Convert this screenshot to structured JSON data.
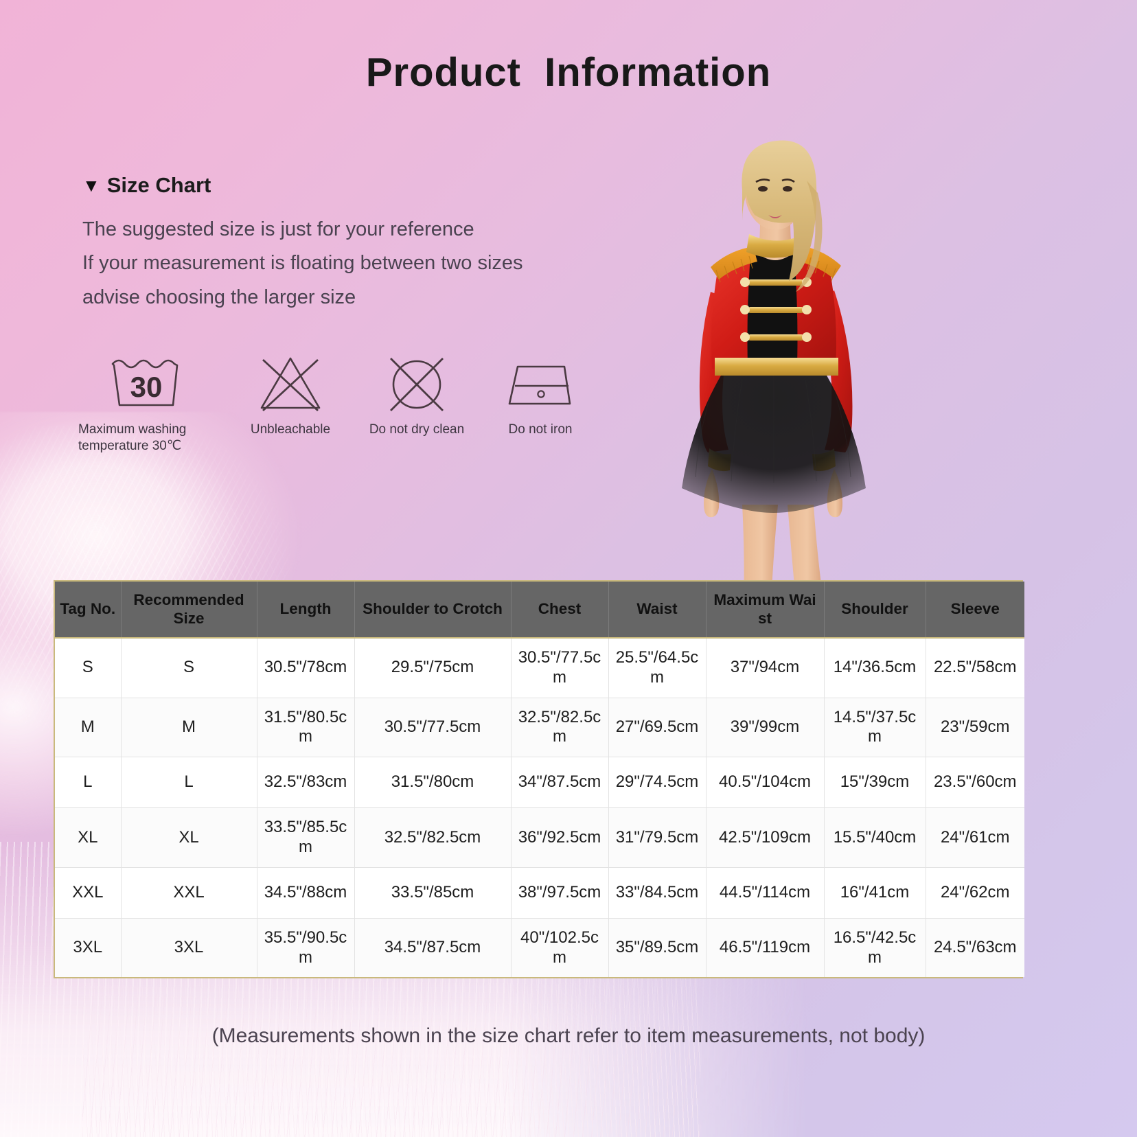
{
  "page": {
    "title": "Product  Information",
    "footnote": "(Measurements shown in the size chart refer to item measurements, not body)"
  },
  "size_chart": {
    "heading": "Size Chart",
    "toggle_icon": "▼",
    "notes": [
      "The suggested size is just for your reference",
      "If your measurement is floating between two sizes",
      "advise choosing the larger size"
    ]
  },
  "care_symbols": [
    {
      "icon": "wash-tub-30-icon",
      "value": "30",
      "label": "Maximum washing\ntemperature 30℃"
    },
    {
      "icon": "no-bleach-triangle-icon",
      "label": "Unbleachable"
    },
    {
      "icon": "no-dry-clean-circle-icon",
      "label": "Do not dry clean"
    },
    {
      "icon": "no-iron-icon",
      "label": "Do not iron"
    }
  ],
  "product_image": {
    "alt": "ringmaster-costume-model",
    "description": "Woman wearing red sequin ringmaster jacket with gold trim and black tutu skirt"
  },
  "chart_data": {
    "type": "table",
    "title": "Size Chart",
    "columns": [
      "Tag No.",
      "Recommended Size",
      "Length",
      "Shoulder to Crotch",
      "Chest",
      "Waist",
      "Maximum Wai st",
      "Shoulder",
      "Sleeve"
    ],
    "rows": [
      [
        "S",
        "S",
        "30.5\"/78cm",
        "29.5\"/75cm",
        "30.5\"/77.5cm",
        "25.5\"/64.5cm",
        "37\"/94cm",
        "14\"/36.5cm",
        "22.5\"/58cm"
      ],
      [
        "M",
        "M",
        "31.5\"/80.5cm",
        "30.5\"/77.5cm",
        "32.5\"/82.5cm",
        "27\"/69.5cm",
        "39\"/99cm",
        "14.5\"/37.5cm",
        "23\"/59cm"
      ],
      [
        "L",
        "L",
        "32.5\"/83cm",
        "31.5\"/80cm",
        "34\"/87.5cm",
        "29\"/74.5cm",
        "40.5\"/104cm",
        "15\"/39cm",
        "23.5\"/60cm"
      ],
      [
        "XL",
        "XL",
        "33.5\"/85.5cm",
        "32.5\"/82.5cm",
        "36\"/92.5cm",
        "31\"/79.5cm",
        "42.5\"/109cm",
        "15.5\"/40cm",
        "24\"/61cm"
      ],
      [
        "XXL",
        "XXL",
        "34.5\"/88cm",
        "33.5\"/85cm",
        "38\"/97.5cm",
        "33\"/84.5cm",
        "44.5\"/114cm",
        "16\"/41cm",
        "24\"/62cm"
      ],
      [
        "3XL",
        "3XL",
        "35.5\"/90.5cm",
        "34.5\"/87.5cm",
        "40\"/102.5cm",
        "35\"/89.5cm",
        "46.5\"/119cm",
        "16.5\"/42.5cm",
        "24.5\"/63cm"
      ]
    ]
  },
  "colors": {
    "background_start": "#f1b3d7",
    "background_end": "#d5c9ef",
    "table_header_bg": "#666666",
    "table_border": "#c9b97c",
    "text_dark": "#1c1c1c",
    "text_body": "#4a4250",
    "costume_red": "#d81f1a",
    "costume_gold": "#d9ab43"
  }
}
